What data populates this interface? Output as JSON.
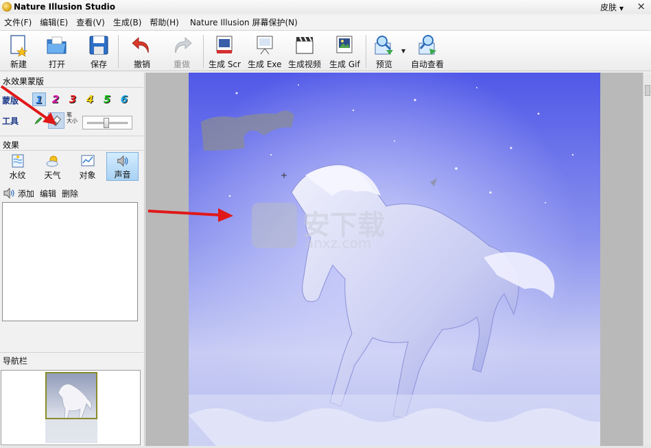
{
  "window": {
    "title": "Nature Illusion Studio",
    "skin_menu": "皮肤",
    "close_glyph": "×"
  },
  "menu": [
    "文件(F)",
    "编辑(E)",
    "查看(V)",
    "生成(B)",
    "帮助(H)",
    "Nature Illusion 屏幕保护(N)"
  ],
  "toolbar": {
    "new": "新建",
    "open": "打开",
    "save": "保存",
    "undo": "撤销",
    "redo": "重做",
    "gen_scr": "生成 Scr",
    "gen_exe": "生成 Exe",
    "gen_video": "生成视频",
    "gen_gif": "生成 Gif",
    "preview": "预览",
    "auto_view": "自动查看"
  },
  "left_panel": {
    "mask_title": "水效果蒙版",
    "mask_label": "蒙版",
    "mask_numbers": [
      "1",
      "2",
      "3",
      "4",
      "5",
      "6"
    ],
    "mask_number_colors": [
      "#2f7fe0",
      "#e01fb0",
      "#e82020",
      "#f0d010",
      "#22c022",
      "#1fa8e8"
    ],
    "tool_label": "工具",
    "size_label_top": "笔",
    "size_label_bottom": "大小",
    "effects_title": "效果",
    "effect_tabs": [
      "水纹",
      "天气",
      "对象",
      "声音"
    ],
    "sound_actions": [
      "添加",
      "编辑",
      "删除"
    ],
    "navigator_title": "导航栏"
  },
  "colors": {
    "arrow_red": "#e01818",
    "image_blue": "#7078e8",
    "active_tab": "#a9d2f3"
  }
}
